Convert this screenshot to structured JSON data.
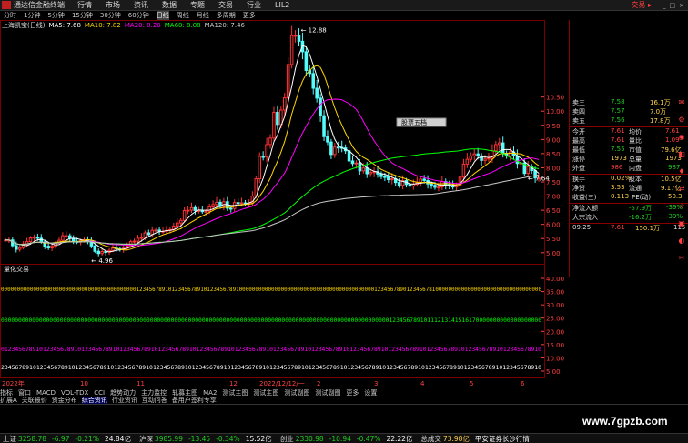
{
  "app": {
    "name": "通达信金融终端",
    "account_menu": "交易 ▸",
    "window_buttons": [
      "_",
      "□",
      "×"
    ]
  },
  "menu": [
    "行情",
    "市场",
    "资讯",
    "数据",
    "专题",
    "交易",
    "行业",
    "LIL2"
  ],
  "periods": [
    "分时",
    "1分钟",
    "5分钟",
    "15分钟",
    "30分钟",
    "60分钟",
    "日线",
    "周线",
    "月线",
    "多周期",
    "更多"
  ],
  "active_period": "日线",
  "chart_title": {
    "name": "上海凯宝(日线)",
    "ma5": "MA5: 7.68",
    "ma10": "MA10: 7.82",
    "ma20": "MA20: 8.20",
    "ma60": "MA60: 8.08",
    "ma120": "MA120: 7.46"
  },
  "colors": {
    "up": "#ff3232",
    "down": "#54fcfc",
    "ma5": "#ffffff",
    "ma10": "#ffd700",
    "ma20": "#ff00ff",
    "ma60": "#00ff00",
    "ma120": "#c8c8c8",
    "grid": "#7a0000",
    "axis": "#ff4040",
    "text_green": "#20d020",
    "text_yellow": "#ffd24a"
  },
  "chart_data": {
    "type": "candlestick",
    "y_axis_ticks": [
      "10.50",
      "10.00",
      "9.50",
      "9.00",
      "8.50",
      "8.00",
      "7.50",
      "7.00",
      "6.50",
      "6.00",
      "5.50",
      "5.00"
    ],
    "ylim": [
      4.8,
      12.9
    ],
    "annotations": {
      "high": "12.88",
      "low": "4.96",
      "last": "7.64"
    },
    "x_labels": [
      "2022年",
      "10",
      "11",
      "12",
      "2022/12/12/一",
      "2",
      "3",
      "4",
      "5",
      "6"
    ],
    "close": [
      5.45,
      5.45,
      5.25,
      5.12,
      5.18,
      5.31,
      5.39,
      5.52,
      5.55,
      5.51,
      5.38,
      5.23,
      5.17,
      5.23,
      5.35,
      5.44,
      5.6,
      5.6,
      5.51,
      5.4,
      5.37,
      5.43,
      5.46,
      5.42,
      5.24,
      5.05,
      4.97,
      5.04,
      5.01,
      5.08,
      5.16,
      5.14,
      5.11,
      5.16,
      5.23,
      5.39,
      5.41,
      5.51,
      5.54,
      5.7,
      5.64,
      5.79,
      5.8,
      5.76,
      5.76,
      5.79,
      5.82,
      5.94,
      6.05,
      6.14,
      6.49,
      6.5,
      6.59,
      6.49,
      6.49,
      6.45,
      6.46,
      6.62,
      6.7,
      6.78,
      6.63,
      6.8,
      6.57,
      6.56,
      6.77,
      6.76,
      6.76,
      6.74,
      6.75,
      7.0,
      7.61,
      8.4,
      8.38,
      8.82,
      9.05,
      9.96,
      9.53,
      10.04,
      10.47,
      11.65,
      12.67,
      12.68,
      12.47,
      12.1,
      11.44,
      11.33,
      10.81,
      10.46,
      9.84,
      9.1,
      8.91,
      8.47,
      8.73,
      8.72,
      8.7,
      8.6,
      8.24,
      8.15,
      8.17,
      7.89,
      7.99,
      7.79,
      7.84,
      7.86,
      7.78,
      7.69,
      7.68,
      7.58,
      7.61,
      7.48,
      7.38,
      7.55,
      7.41,
      7.35,
      7.42,
      7.48,
      7.6,
      7.55,
      7.43,
      7.38,
      7.31,
      7.32,
      7.51,
      7.4,
      7.37,
      7.32,
      7.39,
      7.67,
      8.13,
      8.3,
      8.42,
      8.49,
      8.42,
      8.26,
      8.31,
      8.34,
      8.6,
      8.82,
      8.88,
      8.51,
      8.42,
      8.56,
      8.42,
      8.15,
      8.17,
      7.8,
      8.04,
      7.9,
      7.64,
      7.64
    ],
    "volume_label": "量化交易",
    "indicator_ticks": [
      "40.00",
      "35.00",
      "30.00",
      "25.00",
      "20.00",
      "15.00",
      "10.00",
      "5.00"
    ],
    "indicator_rows": [
      {
        "text": "000000000000000000000000000000000000000000123456789101234567891012345678910000000000000000000000000000000000000000001234567890123456781000000000000000000000000000000000",
        "color": "#ffd700"
      },
      {
        "text": "000000000000000000000000000000000000000000000000000000000000000000000000000000000000000000000000000000000000000012345678910111213141516170000000000000000000",
        "color": "#00ff00"
      },
      {
        "text": "01234567891012345678910123456789101234567891012345678910123456789101234567891012345678910123456789101234567891012345678910123456789101234567891012345678910",
        "color": "#ff00ff"
      },
      {
        "text": "234567891012345678910123456789101234567891012345678910123456789101234567891012345678910123456789101234567891012345678910123456789101234567891012345678910",
        "color": "#ffffff"
      }
    ]
  },
  "quote": {
    "levels": [
      {
        "label": "卖三",
        "price": "7.58",
        "vol": "16.1万"
      },
      {
        "label": "卖四",
        "price": "7.57",
        "vol": "7.0万"
      },
      {
        "label": "卖五",
        "price": "7.56",
        "vol": "17.8万"
      }
    ],
    "rows": [
      {
        "l": "今开",
        "v": "7.61",
        "l2": "均价",
        "v2": "7.61"
      },
      {
        "l": "最高",
        "v": "7.61",
        "l2": "量比",
        "v2": "1.09"
      },
      {
        "l": "最低",
        "v": "7.55",
        "l2": "市值",
        "v2": "79.6亿"
      },
      {
        "l": "涨停",
        "v": "1973",
        "l2": "总量",
        "v2": "1973"
      },
      {
        "l": "外盘",
        "v": "986",
        "l2": "内盘",
        "v2": "987"
      },
      {
        "l": "换手",
        "v": "0.02%",
        "l2": "股本",
        "v2": "10.5亿"
      },
      {
        "l": "净资",
        "v": "3.53",
        "l2": "流通",
        "v2": "9.17亿"
      },
      {
        "l": "收益(三)",
        "v": "0.113",
        "l2": "PE(动)",
        "v2": "50.3"
      }
    ],
    "flows": [
      {
        "l": "净流入额",
        "v": "-57.9万",
        "p": "-39%"
      },
      {
        "l": "大宗流入",
        "v": "-16.2万",
        "p": "-39%"
      }
    ],
    "tick": {
      "time": "09:25",
      "price": "7.61",
      "vol": "150.1万",
      "n": "115"
    }
  },
  "popup": "股票五档",
  "right_tools": [
    "✉",
    "⚙",
    "◉",
    "◧",
    "♦",
    "⇄",
    "☆",
    "▣",
    "◐",
    "✂"
  ],
  "tabs_row1": [
    "指标",
    "窗口",
    "MACD",
    "VOL-TDX",
    "CCI",
    "趋势动力",
    "主力监控",
    "轧募主图",
    "MA2",
    "测试主图",
    "测试主图",
    "测试副图",
    "测试副图",
    "更多",
    "设置"
  ],
  "tabs_row2": [
    "扩展A",
    "关联报价",
    "资金分布",
    "综合资讯",
    "行业资讯",
    "互动问答",
    "备用户签利专享"
  ],
  "status": [
    {
      "n": "上证",
      "v": "3258.78",
      "c": "-6.97",
      "p": "-0.21%",
      "a": "24.84亿"
    },
    {
      "n": "沪深",
      "v": "3985.99",
      "c": "-13.45",
      "p": "-0.34%",
      "a": "15.52亿"
    },
    {
      "n": "创业",
      "v": "2330.98",
      "c": "-10.94",
      "p": "-0.47%",
      "a": "22.22亿"
    }
  ],
  "status_extra": {
    "label": "总成交",
    "value": "73.98亿",
    "news": "平安证券长沙行情"
  },
  "watermark": "www.7gpzb.com"
}
